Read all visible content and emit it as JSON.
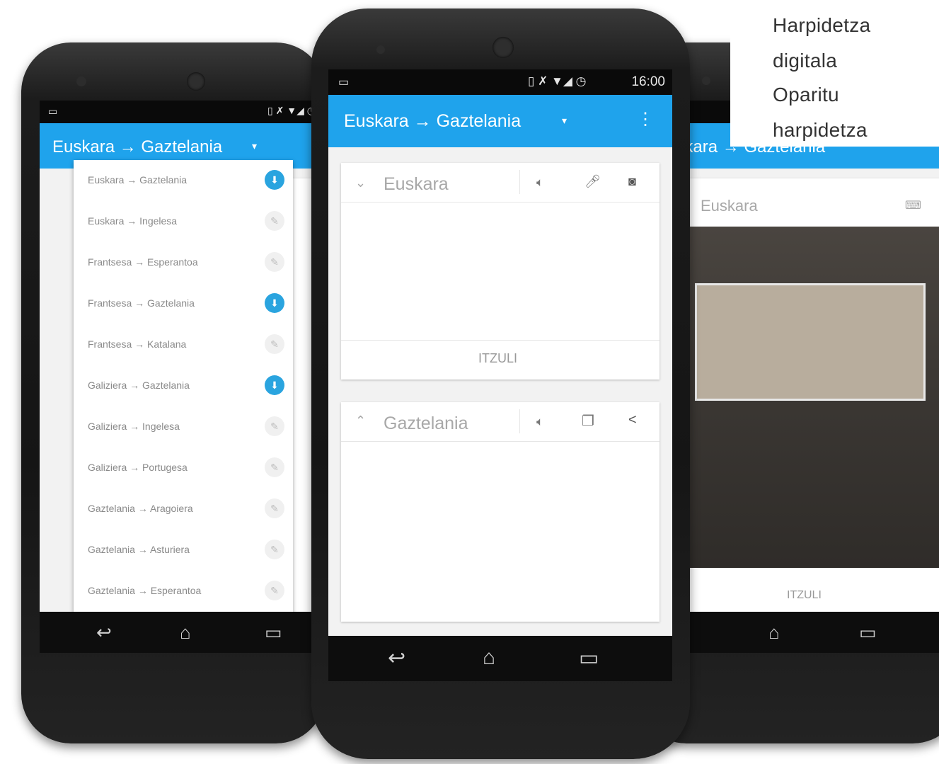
{
  "promo": {
    "line1": "Harpidetza",
    "line2": "digitala",
    "line3": "Oparitu",
    "line4": "harpidetza"
  },
  "center_phone": {
    "status_time": "16:00",
    "app_title": "Euskara → Gaztelania",
    "source_lang": "Euskara",
    "translate_button": "ITZULI",
    "target_lang": "Gaztelania"
  },
  "left_phone": {
    "app_title": "Euskara → Gaztelania",
    "pairs": [
      {
        "label": "Euskara → Gaztelania",
        "pinned": true
      },
      {
        "label": "Euskara → Ingelesa",
        "pinned": false
      },
      {
        "label": "Frantsesa → Esperantoa",
        "pinned": false
      },
      {
        "label": "Frantsesa → Gaztelania",
        "pinned": true
      },
      {
        "label": "Frantsesa → Katalana",
        "pinned": false
      },
      {
        "label": "Galiziera → Gaztelania",
        "pinned": true
      },
      {
        "label": "Galiziera → Ingelesa",
        "pinned": false
      },
      {
        "label": "Galiziera → Portugesa",
        "pinned": false
      },
      {
        "label": "Gaztelania → Aragoiera",
        "pinned": false
      },
      {
        "label": "Gaztelania → Asturiera",
        "pinned": false
      },
      {
        "label": "Gaztelania → Esperantoa",
        "pinned": false
      }
    ]
  },
  "right_phone": {
    "app_title": "Euskara → Gaztelania",
    "source_lang": "Euskara",
    "translate_button": "ITZULI"
  },
  "colors": {
    "appbar": "#1fa3ec",
    "phone_body": "#1a1a1a",
    "pin_active": "#2aa4df"
  },
  "icons": [
    "back-icon",
    "home-icon",
    "recents-icon",
    "speaker-icon",
    "mic-icon",
    "camera-icon",
    "copy-icon",
    "share-icon",
    "pin-icon",
    "dropdown-arrow-icon",
    "overflow-menu-icon",
    "wifi-icon",
    "signal-icon",
    "clock-icon",
    "vibrate-icon"
  ]
}
